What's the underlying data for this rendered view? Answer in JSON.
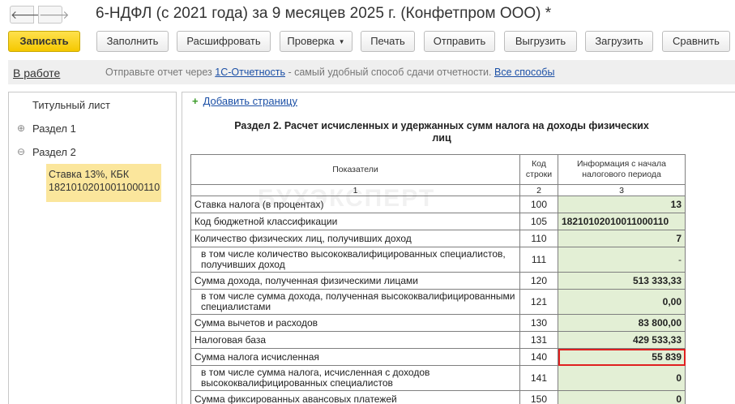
{
  "window": {
    "back_glyph": "🡐",
    "forward_glyph": "🡒",
    "title": "6-НДФЛ (с 2021 года) за 9 месяцев 2025 г. (Конфетпром ООО) *"
  },
  "toolbar": {
    "save": "Записать",
    "fill": "Заполнить",
    "decode": "Расшифровать",
    "check": "Проверка",
    "print": "Печать",
    "send": "Отправить",
    "upload": "Выгрузить",
    "load": "Загрузить",
    "compare": "Сравнить"
  },
  "infobar": {
    "status": "В работе",
    "hint_prefix": "Отправьте отчет через ",
    "hint_link": "1С-Отчетность",
    "hint_middle": " - самый удобный способ сдачи отчетности. ",
    "hint_all": "Все способы"
  },
  "tree": {
    "items": [
      {
        "label": "Титульный лист",
        "expander": ""
      },
      {
        "label": "Раздел 1",
        "expander": "⊕"
      },
      {
        "label": "Раздел 2",
        "expander": "⊖"
      }
    ],
    "selected_line1": "Ставка 13%, КБК",
    "selected_line2": "18210102010011000110"
  },
  "form": {
    "add_page_icon": "+",
    "add_page": "Добавить страницу",
    "section_title": "Раздел 2. Расчет исчисленных и удержанных сумм налога на доходы физических лиц",
    "col_indicators": "Показатели",
    "col_code": "Код строки",
    "col_info": "Информация с начала налогового периода",
    "col_num1": "1",
    "col_num2": "2",
    "col_num3": "3",
    "rows": [
      {
        "label": "Ставка налога (в процентах)",
        "code": "100",
        "value": "13"
      },
      {
        "label": "Код бюджетной классификации",
        "code": "105",
        "value": "18210102010011000110"
      },
      {
        "label": "Количество физических лиц, получивших доход",
        "code": "110",
        "value": "7"
      },
      {
        "label": "в том числе количество высококвалифицированных специалистов, получивших доход",
        "code": "111",
        "value": "-"
      },
      {
        "label": "Сумма дохода, полученная физическими лицами",
        "code": "120",
        "value": "513 333,33"
      },
      {
        "label": "в том числе сумма дохода, полученная высококвалифицированными специалистами",
        "code": "121",
        "value": "0,00"
      },
      {
        "label": "Сумма вычетов и расходов",
        "code": "130",
        "value": "83 800,00"
      },
      {
        "label": "Налоговая база",
        "code": "131",
        "value": "429 533,33"
      },
      {
        "label": "Сумма налога исчисленная",
        "code": "140",
        "value": "55 839"
      },
      {
        "label": "в том числе сумма налога, исчисленная с доходов высококвалифицированных специалистов",
        "code": "141",
        "value": "0"
      },
      {
        "label": "Сумма фиксированных авансовых платежей",
        "code": "150",
        "value": "0"
      }
    ]
  },
  "watermark": "БУХЭКСПЕРТ"
}
